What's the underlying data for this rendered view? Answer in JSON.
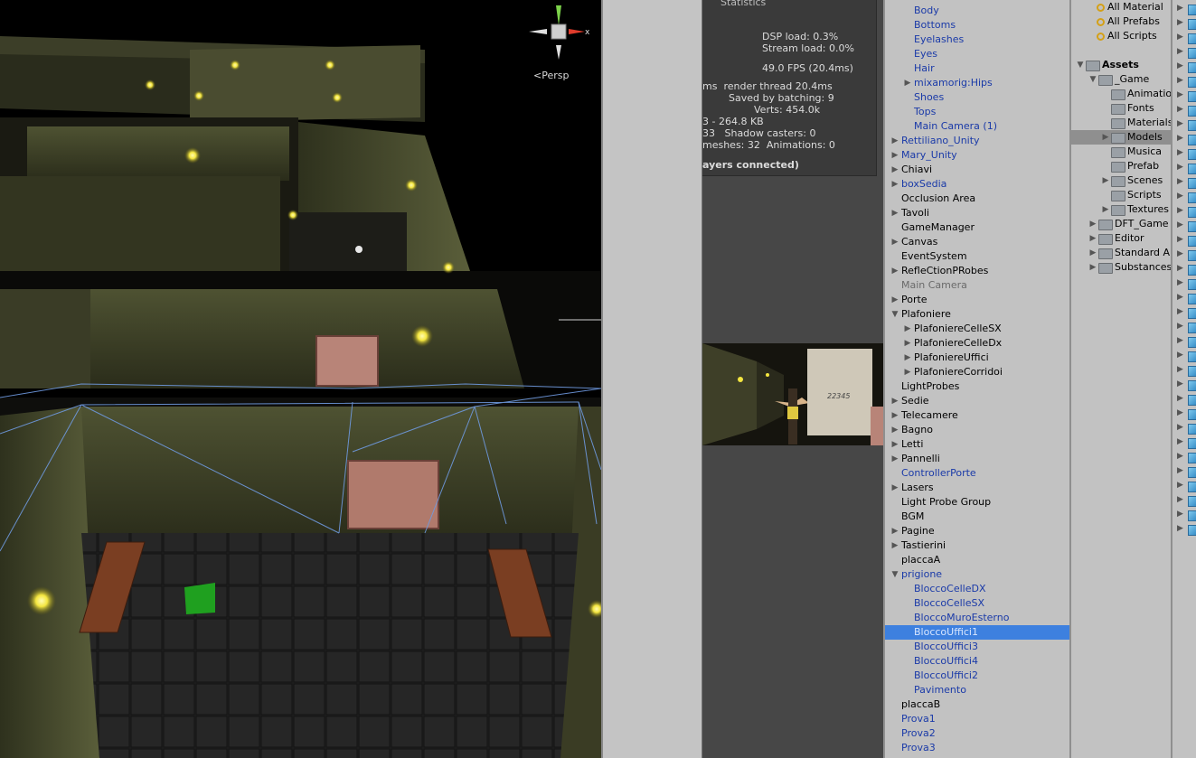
{
  "scene": {
    "view_mode": "Persp",
    "gizmo_axis_label": "x"
  },
  "stats": {
    "title": "Statistics",
    "lines": [
      "DSP load: 0.3%",
      "Stream load: 0.0%",
      "49.0 FPS (20.4ms)",
      "ms  render thread 20.4ms",
      "Saved by batching: 9",
      "Verts: 454.0k",
      "3 - 264.8 KB",
      "33   Shadow casters: 0",
      "meshes: 32  Animations: 0",
      "ayers connected)"
    ]
  },
  "game_view": {
    "note_text": "22345"
  },
  "hierarchy": {
    "items": [
      {
        "label": "Body",
        "indent": 2,
        "arrow": "",
        "style": "prefab"
      },
      {
        "label": "Bottoms",
        "indent": 2,
        "arrow": "",
        "style": "prefab"
      },
      {
        "label": "Eyelashes",
        "indent": 2,
        "arrow": "",
        "style": "prefab"
      },
      {
        "label": "Eyes",
        "indent": 2,
        "arrow": "",
        "style": "prefab"
      },
      {
        "label": "Hair",
        "indent": 2,
        "arrow": "",
        "style": "prefab"
      },
      {
        "label": "mixamorig:Hips",
        "indent": 2,
        "arrow": "▶",
        "style": "prefab"
      },
      {
        "label": "Shoes",
        "indent": 2,
        "arrow": "",
        "style": "prefab"
      },
      {
        "label": "Tops",
        "indent": 2,
        "arrow": "",
        "style": "prefab"
      },
      {
        "label": "Main Camera (1)",
        "indent": 2,
        "arrow": "",
        "style": "prefab"
      },
      {
        "label": "Rettiliano_Unity",
        "indent": 1,
        "arrow": "▶",
        "style": "prefab"
      },
      {
        "label": "Mary_Unity",
        "indent": 1,
        "arrow": "▶",
        "style": "prefab"
      },
      {
        "label": "Chiavi",
        "indent": 1,
        "arrow": "▶",
        "style": ""
      },
      {
        "label": "boxSedia",
        "indent": 1,
        "arrow": "▶",
        "style": "prefab"
      },
      {
        "label": "Occlusion Area",
        "indent": 1,
        "arrow": "",
        "style": ""
      },
      {
        "label": "Tavoli",
        "indent": 1,
        "arrow": "▶",
        "style": ""
      },
      {
        "label": "GameManager",
        "indent": 1,
        "arrow": "",
        "style": ""
      },
      {
        "label": "Canvas",
        "indent": 1,
        "arrow": "▶",
        "style": ""
      },
      {
        "label": "EventSystem",
        "indent": 1,
        "arrow": "",
        "style": ""
      },
      {
        "label": "RefleCtionPRobes",
        "indent": 1,
        "arrow": "▶",
        "style": ""
      },
      {
        "label": "Main Camera",
        "indent": 1,
        "arrow": "",
        "style": "inactive"
      },
      {
        "label": "Porte",
        "indent": 1,
        "arrow": "▶",
        "style": ""
      },
      {
        "label": "Plafoniere",
        "indent": 1,
        "arrow": "▼",
        "style": ""
      },
      {
        "label": "PlafoniereCelleSX",
        "indent": 2,
        "arrow": "▶",
        "style": ""
      },
      {
        "label": "PlafoniereCelleDx",
        "indent": 2,
        "arrow": "▶",
        "style": ""
      },
      {
        "label": "PlafoniereUffici",
        "indent": 2,
        "arrow": "▶",
        "style": ""
      },
      {
        "label": "PlafoniereCorridoi",
        "indent": 2,
        "arrow": "▶",
        "style": ""
      },
      {
        "label": "LightProbes",
        "indent": 1,
        "arrow": "",
        "style": ""
      },
      {
        "label": "Sedie",
        "indent": 1,
        "arrow": "▶",
        "style": ""
      },
      {
        "label": "Telecamere",
        "indent": 1,
        "arrow": "▶",
        "style": ""
      },
      {
        "label": "Bagno",
        "indent": 1,
        "arrow": "▶",
        "style": ""
      },
      {
        "label": "Letti",
        "indent": 1,
        "arrow": "▶",
        "style": ""
      },
      {
        "label": "Pannelli",
        "indent": 1,
        "arrow": "▶",
        "style": ""
      },
      {
        "label": "ControllerPorte",
        "indent": 1,
        "arrow": "",
        "style": "prefab"
      },
      {
        "label": "Lasers",
        "indent": 1,
        "arrow": "▶",
        "style": ""
      },
      {
        "label": "Light Probe Group",
        "indent": 1,
        "arrow": "",
        "style": ""
      },
      {
        "label": "BGM",
        "indent": 1,
        "arrow": "",
        "style": ""
      },
      {
        "label": "Pagine",
        "indent": 1,
        "arrow": "▶",
        "style": ""
      },
      {
        "label": "Tastierini",
        "indent": 1,
        "arrow": "▶",
        "style": ""
      },
      {
        "label": "placcaA",
        "indent": 1,
        "arrow": "",
        "style": ""
      },
      {
        "label": "prigione",
        "indent": 1,
        "arrow": "▼",
        "style": "prefab"
      },
      {
        "label": "BloccoCelleDX",
        "indent": 2,
        "arrow": "",
        "style": "prefab"
      },
      {
        "label": "BloccoCelleSX",
        "indent": 2,
        "arrow": "",
        "style": "prefab"
      },
      {
        "label": "BloccoMuroEsterno",
        "indent": 2,
        "arrow": "",
        "style": "prefab"
      },
      {
        "label": "BloccoUffici1",
        "indent": 2,
        "arrow": "",
        "style": "selected"
      },
      {
        "label": "BloccoUffici3",
        "indent": 2,
        "arrow": "",
        "style": "prefab"
      },
      {
        "label": "BloccoUffici4",
        "indent": 2,
        "arrow": "",
        "style": "prefab"
      },
      {
        "label": "BloccoUffici2",
        "indent": 2,
        "arrow": "",
        "style": "prefab"
      },
      {
        "label": "Pavimento",
        "indent": 2,
        "arrow": "",
        "style": "prefab"
      },
      {
        "label": "placcaB",
        "indent": 1,
        "arrow": "",
        "style": ""
      },
      {
        "label": "Prova1",
        "indent": 1,
        "arrow": "",
        "style": "prefab"
      },
      {
        "label": "Prova2",
        "indent": 1,
        "arrow": "",
        "style": "prefab"
      },
      {
        "label": "Prova3",
        "indent": 1,
        "arrow": "",
        "style": "prefab"
      }
    ]
  },
  "project": {
    "favorites": [
      "All Material",
      "All Prefabs",
      "All Scripts"
    ],
    "tree": [
      {
        "label": "Assets",
        "indent": 0,
        "arrow": "▼",
        "bold": true
      },
      {
        "label": "_Game",
        "indent": 1,
        "arrow": "▼"
      },
      {
        "label": "Animatio",
        "indent": 2,
        "arrow": ""
      },
      {
        "label": "Fonts",
        "indent": 2,
        "arrow": ""
      },
      {
        "label": "Materials",
        "indent": 2,
        "arrow": ""
      },
      {
        "label": "Models",
        "indent": 2,
        "arrow": "▶",
        "selected": true
      },
      {
        "label": "Musica",
        "indent": 2,
        "arrow": ""
      },
      {
        "label": "Prefab",
        "indent": 2,
        "arrow": ""
      },
      {
        "label": "Scenes",
        "indent": 2,
        "arrow": "▶"
      },
      {
        "label": "Scripts",
        "indent": 2,
        "arrow": ""
      },
      {
        "label": "Textures",
        "indent": 2,
        "arrow": "▶"
      },
      {
        "label": "DFT_Game",
        "indent": 1,
        "arrow": "▶"
      },
      {
        "label": "Editor",
        "indent": 1,
        "arrow": "▶"
      },
      {
        "label": "Standard A",
        "indent": 1,
        "arrow": "▶"
      },
      {
        "label": "Substances",
        "indent": 1,
        "arrow": "▶"
      }
    ]
  }
}
